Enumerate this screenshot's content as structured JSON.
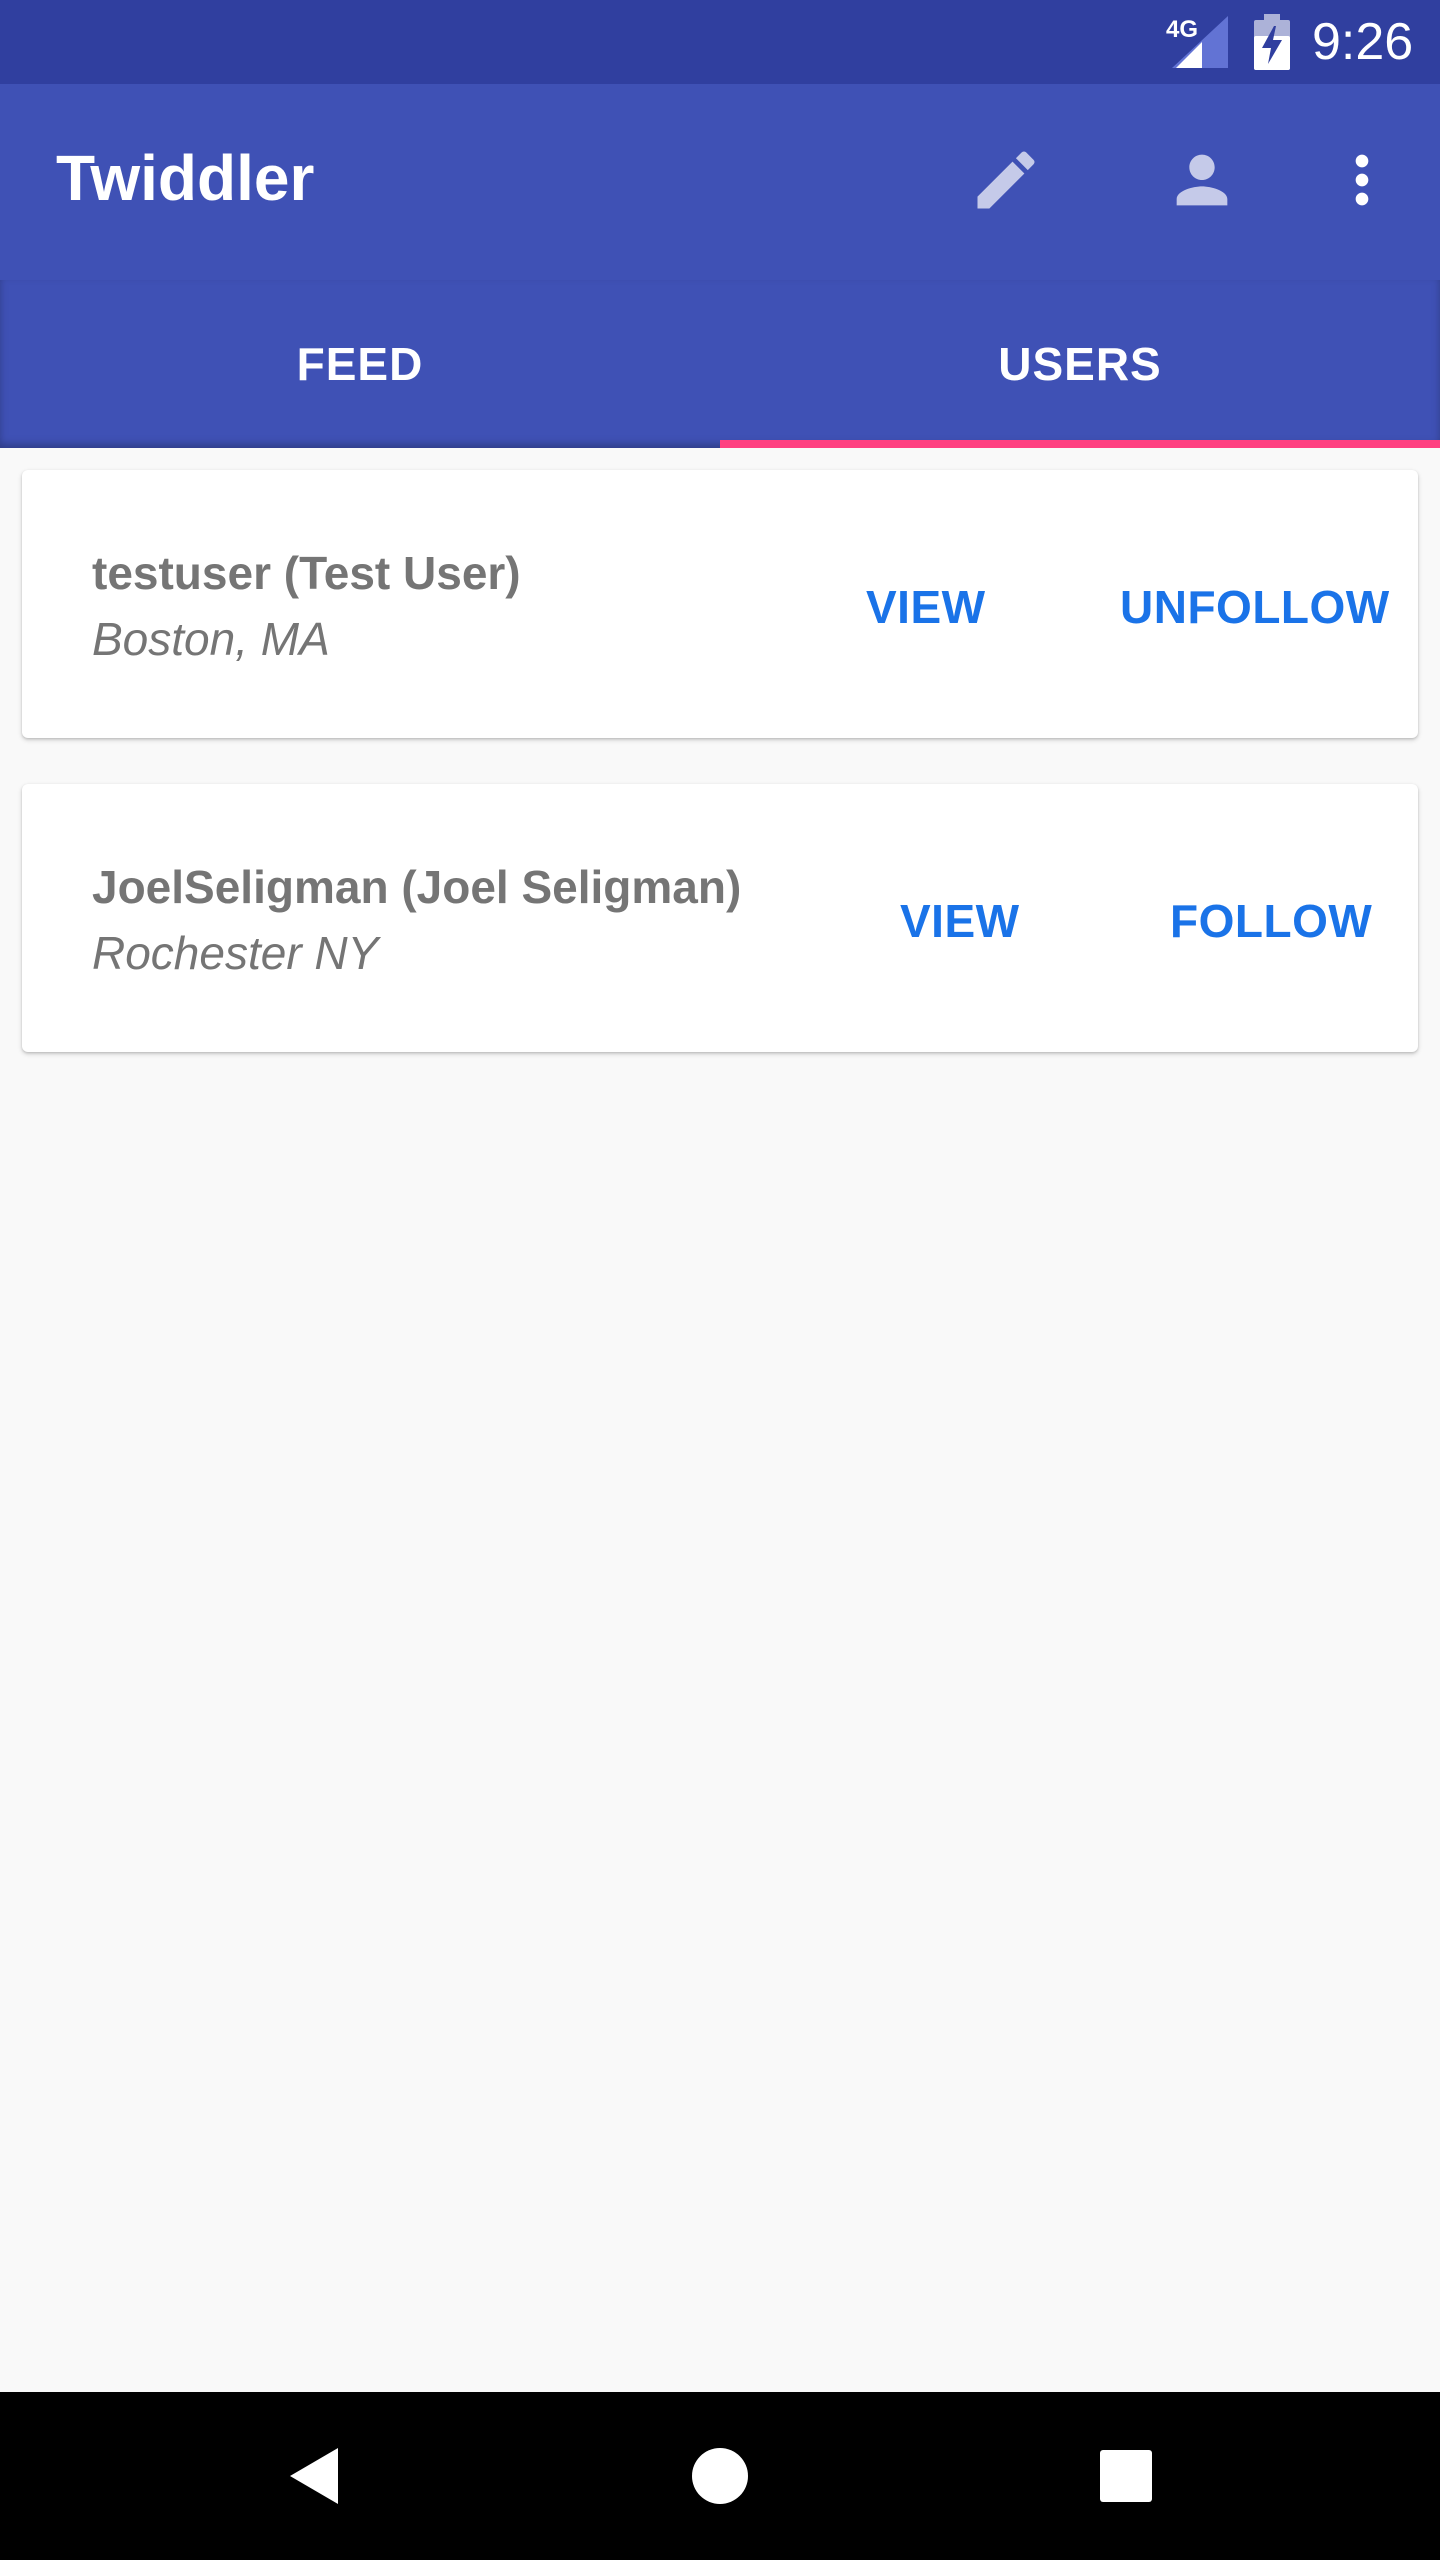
{
  "status_bar": {
    "network": "4G",
    "time": "9:26"
  },
  "app_bar": {
    "title": "Twiddler",
    "actions": [
      {
        "icon": "pencil-icon"
      },
      {
        "icon": "person-icon"
      },
      {
        "icon": "more-vert-icon"
      }
    ]
  },
  "tabs": [
    {
      "label": "FEED",
      "selected": false
    },
    {
      "label": "USERS",
      "selected": true
    }
  ],
  "users": [
    {
      "name": "testuser (Test User)",
      "location": "Boston, MA",
      "view_label": "VIEW",
      "follow_label": "UNFOLLOW"
    },
    {
      "name": "JoelSeligman (Joel Seligman)",
      "location": "Rochester NY",
      "view_label": "VIEW",
      "follow_label": "FOLLOW"
    }
  ],
  "colors": {
    "status_bar": "#303f9f",
    "app_bar": "#3f51b5",
    "tab_indicator": "#ff4081",
    "button_text": "#1a73e8",
    "secondary_text": "#757575",
    "background": "#f9f9f9"
  },
  "nav_bar": {
    "buttons": [
      "back-icon",
      "home-icon",
      "recents-icon"
    ]
  }
}
